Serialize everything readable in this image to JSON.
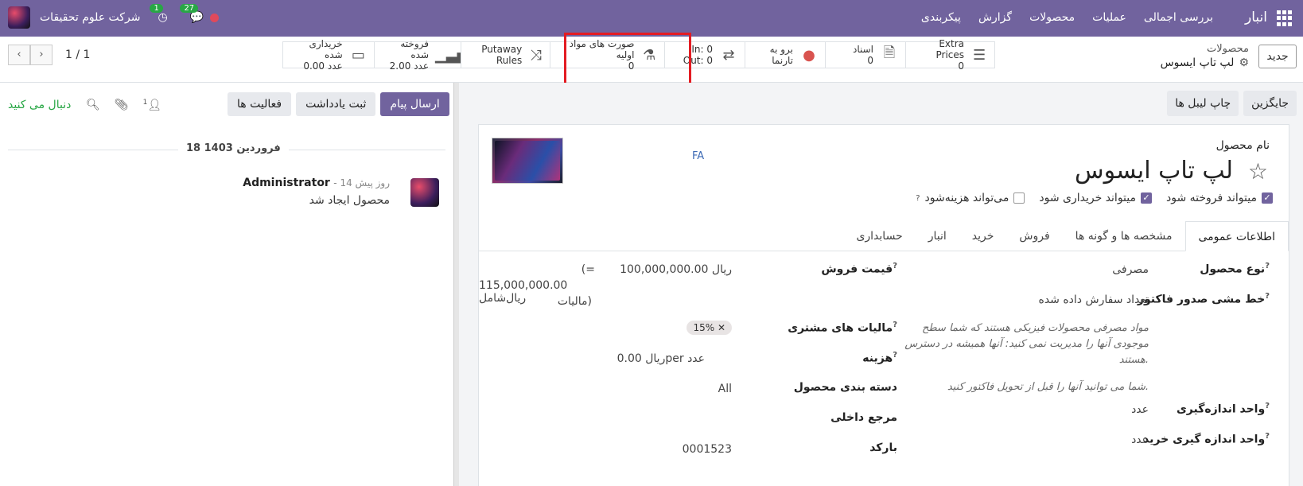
{
  "navbar": {
    "brand": "انبار",
    "menu": [
      "بررسی اجمالی",
      "عملیات",
      "محصولات",
      "گزارش",
      "پیکربندی"
    ],
    "company": "شرکت علوم تحقیقات",
    "activity_count": "1",
    "messages_count": "27"
  },
  "control": {
    "new_button": "جدید",
    "breadcrumb_parent": "محصولات",
    "breadcrumb_current": "لپ تاپ ایسوس",
    "pager": "1 / 1",
    "smart_buttons": [
      {
        "icon": "list-icon",
        "label": "Extra Prices",
        "value": "0"
      },
      {
        "icon": "document-icon",
        "label": "اسناد",
        "value": "0"
      },
      {
        "icon": "globe-icon",
        "label": "برو به",
        "value": "تارنما"
      },
      {
        "icon": "transfer-icon",
        "label": "In: 0",
        "value": "Out: 0"
      },
      {
        "icon": "flask-icon",
        "label": "صورت های مواد اولیه",
        "value": "0"
      },
      {
        "icon": "shuffle-icon",
        "label": "Putaway Rules",
        "value": ""
      },
      {
        "icon": "bar-chart-icon",
        "label": "فروخته شده",
        "value": "2.00 عدد"
      },
      {
        "icon": "credit-card-icon",
        "label": "خریداری شده",
        "value": "0.00 عدد"
      }
    ]
  },
  "form": {
    "action_buttons": [
      "جایگزین",
      "چاپ لیبل ها"
    ],
    "name_label": "نام محصول",
    "product_name": "لپ تاپ ایسوس",
    "fa_text": "FA",
    "checks": [
      {
        "label": "میتواند فروخته شود",
        "checked": true
      },
      {
        "label": "میتواند خریداری شود",
        "checked": true
      },
      {
        "label": "می‌تواند هزینه‌شود",
        "checked": false
      }
    ],
    "tabs": [
      "اطلاعات عمومی",
      "مشخصه ها و گونه ها",
      "فروش",
      "خرید",
      "انبار",
      "حسابداری"
    ],
    "fields": {
      "product_type_label": "نوع محصول",
      "product_type_value": "مصرفی",
      "invoice_policy_label": "خط مشی صدور فاکتور",
      "invoice_policy_value": "تعداد سفارش داده شده",
      "consumable_hint": "مواد مصرفی محصولات فیزیکی هستند که شما سطح موجودی آنها را مدیریت نمی کنید: آنها همیشه در دسترس هستند.",
      "invoice_hint": "شما می توانید آنها را قبل از تحویل فاکتور کنید.",
      "uom_label": "واحد اندازه‌گیری",
      "uom_value": "عدد",
      "purchase_uom_label": "واحد اندازه گیری خرید",
      "purchase_uom_value": "عدد",
      "sales_price_label": "قیمت فروش",
      "sales_price_value": "100,000,000.00 ریال",
      "sales_price_incl_1": "(=",
      "sales_price_incl_2": "115,000,000.00 ریال‌شامل",
      "sales_price_incl_3": "مالیات)",
      "customer_taxes_label": "مالیات های مشتری",
      "customer_taxes_tag": "15%",
      "cost_label": "هزینه",
      "cost_value": "0.00 ریالper عدد",
      "category_label": "دسته بندی محصول",
      "category_value": "All",
      "internal_ref_label": "مرجع داخلی",
      "barcode_label": "بارکد",
      "barcode_value": "0001523"
    }
  },
  "chatter": {
    "send_message": "ارسال پیام",
    "log_note": "ثبت یادداشت",
    "activities": "فعالیت ها",
    "followers_count": "1",
    "follow": "دنبال می کنید",
    "date": "18 فروردین 1403",
    "author": "Administrator",
    "time_ago": "- 14 روز پیش",
    "message": "محصول ایجاد شد"
  }
}
